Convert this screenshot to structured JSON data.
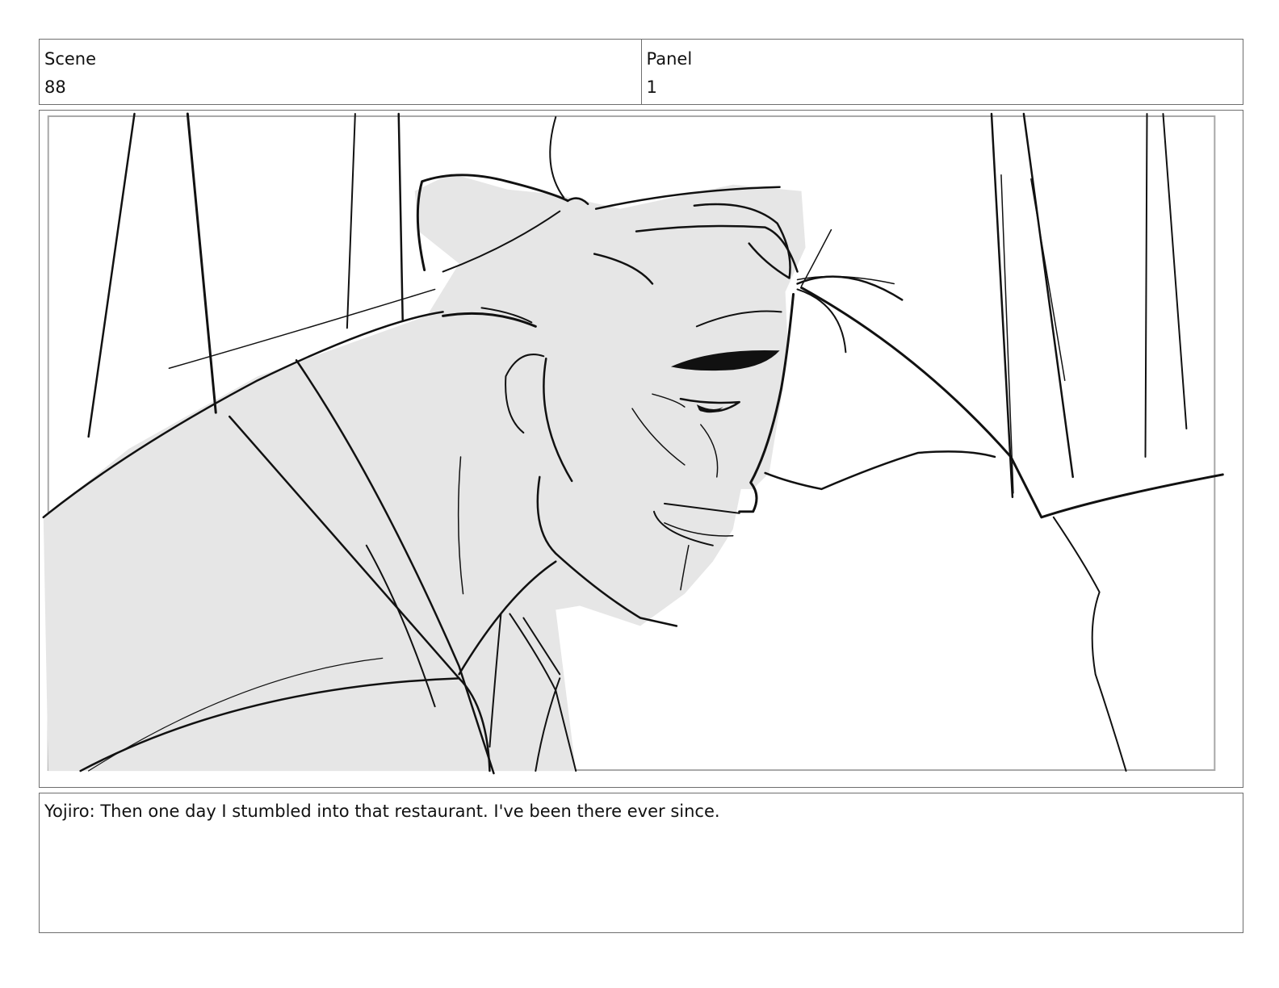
{
  "header": {
    "scene_label": "Scene",
    "scene_value": "88",
    "panel_label": "Panel",
    "panel_value": "1"
  },
  "panel": {
    "image_name": "storyboard-sketch",
    "line_color": "#111111",
    "fill_color": "#e6e6e6",
    "guide_color": "#a8a8a8"
  },
  "caption": {
    "dialogue": "Yojiro: Then one day I stumbled into that restaurant. I've been there ever since."
  }
}
